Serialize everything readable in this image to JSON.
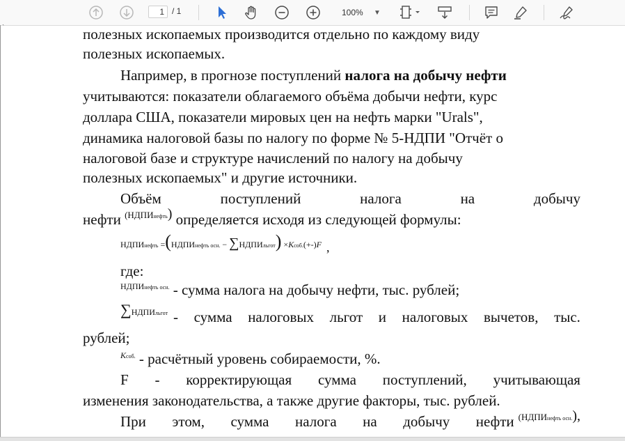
{
  "toolbar": {
    "page_current": "1",
    "page_total": "/ 1",
    "zoom": "100%",
    "icons": [
      "arrow-up-icon",
      "arrow-down-icon",
      "cursor-icon",
      "hand-icon",
      "zoom-out-icon",
      "zoom-in-icon",
      "zoom-caret-icon",
      "fit-page-icon",
      "scroll-mode-icon",
      "comment-icon",
      "highlight-icon",
      "sign-icon"
    ]
  },
  "left_marker": "ˎ",
  "doc": {
    "line1": "полезных ископаемых производится отдельно по каждому виду",
    "line2": "полезных ископаемых.",
    "p2_prefix": "Например, в прогнозе поступлений ",
    "p2_bold": "налога на добычу нефти",
    "p2_line2": "учитываются: показатели облагаемого объёма добычи нефти, курс",
    "p2_line3": "доллара США, показатели мировых цен на нефть марки \"Urals\",",
    "p2_line4": "динамика налоговой базы по налогу по форме № 5-НДПИ \"Отчёт о",
    "p2_line5": "налоговой базе и структуре начислений по налогу на добычу",
    "p2_line6": "полезных ископаемых\" и другие источники.",
    "p3_words": [
      "Объём",
      "поступлений",
      "налога",
      "на",
      "добычу"
    ],
    "p3_line2_a": "нефти",
    "p3_line2_sym": "(НДПИ",
    "p3_line2_sub": "нефть",
    "p3_line2_close": ")",
    "p3_line2_b": "определяется исходя из следующей формулы:",
    "formula": {
      "lhs": "НДПИ",
      "lhs_sub": "нефть",
      "eq": "=",
      "open": "(",
      "t1": "НДПИ",
      "t1_sub": "нефть осн.",
      "minus": "−",
      "sigma": "∑",
      "t2": "НДПИ",
      "t2_sub": "льгот",
      "close": ")",
      "times": "×",
      "k": "K",
      "k_sub": "соб.",
      "pm": "(+-)",
      "f": "F",
      "comma": ","
    },
    "where": "где:",
    "def1_sym": "НДПИ",
    "def1_sub": "нефть осн.",
    "def1_text": "- сумма налога на добычу нефти, тыс. рублей;",
    "def2_sigma": "∑",
    "def2_sym": "НДПИ",
    "def2_sub": "льгот",
    "def2_words": [
      "-",
      "сумма",
      "налоговых",
      "льгот",
      "и",
      "налоговых",
      "вычетов,",
      "тыс."
    ],
    "def2_line2": "рублей;",
    "def3_sym": "K",
    "def3_sub": "соб.",
    "def3_text": "- расчётный уровень собираемости, %.",
    "def4_words": [
      "F",
      "-",
      "корректирующая",
      "сумма",
      "поступлений,",
      "учитывающая"
    ],
    "def4_line2": "изменения законодательства, а также другие факторы, тыс. рублей.",
    "last_words": [
      "При",
      "этом,",
      "сумма",
      "налога",
      "на",
      "добычу",
      "нефти"
    ],
    "last_sym": "(НДПИ",
    "last_sub": "нефть осн.",
    "last_close": "),"
  }
}
